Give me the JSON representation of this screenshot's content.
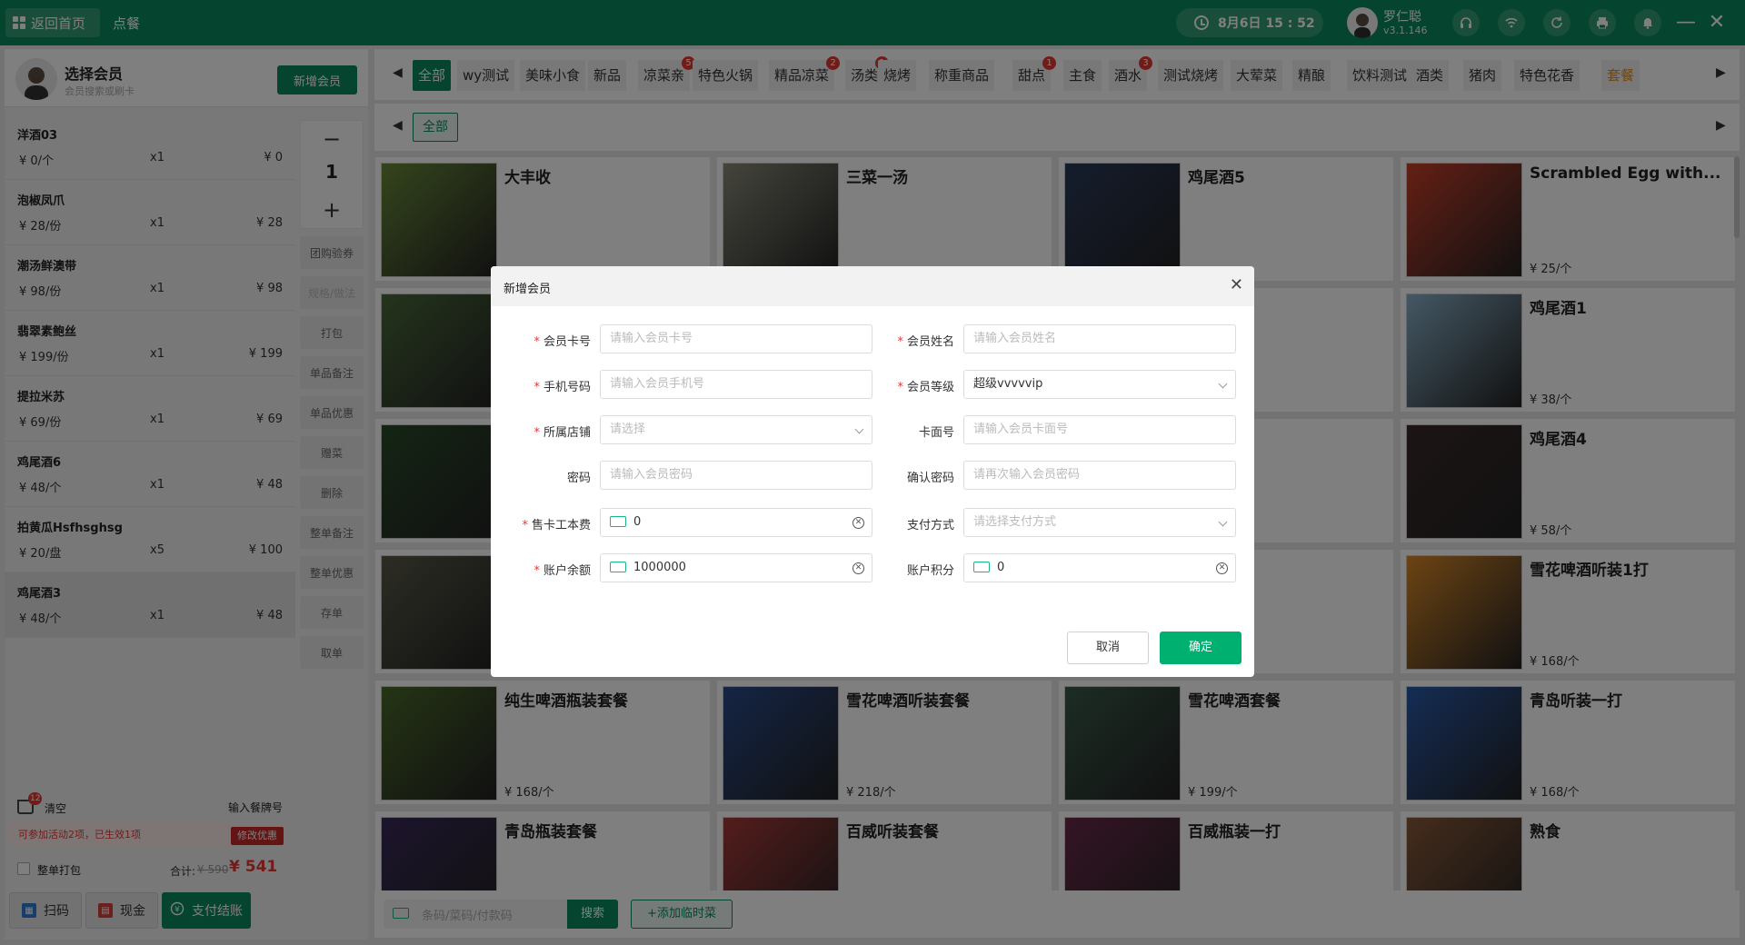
{
  "topbar": {
    "home_label": "返回首页",
    "tab_title": "点餐",
    "datetime": "8月6日  15 : 52",
    "user_name": "罗仁聪",
    "version": "v3.1.146"
  },
  "member": {
    "title": "选择会员",
    "subtitle": "会员搜索或刷卡",
    "add_button": "新增会员"
  },
  "order_items": [
    {
      "name": "洋酒03",
      "price": "¥ 0/个",
      "qty": "x1",
      "total": "¥ 0"
    },
    {
      "name": "泡椒凤爪",
      "price": "¥ 28/份",
      "qty": "x1",
      "total": "¥ 28"
    },
    {
      "name": "潮汤鲜澳带",
      "price": "¥ 98/份",
      "qty": "x1",
      "total": "¥ 98"
    },
    {
      "name": "翡翠素鲍丝",
      "price": "¥ 199/份",
      "qty": "x1",
      "total": "¥ 199"
    },
    {
      "name": "提拉米苏",
      "price": "¥ 69/份",
      "qty": "x1",
      "total": "¥ 69"
    },
    {
      "name": "鸡尾酒6",
      "price": "¥ 48/个",
      "qty": "x1",
      "total": "¥ 48"
    },
    {
      "name": "拍黄瓜Hsfhsghsg",
      "price": "¥ 20/盘",
      "qty": "x5",
      "total": "¥ 100"
    },
    {
      "name": "鸡尾酒3",
      "price": "¥ 48/个",
      "qty": "x1",
      "total": "¥ 48"
    }
  ],
  "stepper": {
    "minus": "−",
    "value": "1",
    "plus": "+"
  },
  "actions": [
    "团购验券",
    "规格/做法",
    "打包",
    "单品备注",
    "单品优惠",
    "赠菜",
    "删除",
    "整单备注",
    "整单优惠",
    "存单",
    "取单"
  ],
  "cart": {
    "badge": "12",
    "clear": "清空",
    "table_no": "输入餐牌号",
    "promo_text": "可参加活动2项，已生效1项",
    "promo_button": "修改优惠",
    "pack_label": "整单打包",
    "sum_label": "合计:",
    "sum_old": "¥ 590",
    "sum_new": "¥ 541"
  },
  "pay_buttons": {
    "scan": "扫码",
    "cash": "现金",
    "checkout": "支付结账"
  },
  "categories": [
    {
      "label": "全部",
      "badge": ""
    },
    {
      "label": "wy测试",
      "badge": ""
    },
    {
      "label": "美味小食",
      "badge": ""
    },
    {
      "label": "新品",
      "badge": ""
    },
    {
      "label": "凉菜亲",
      "badge": "5"
    },
    {
      "label": "特色火锅",
      "badge": ""
    },
    {
      "label": "精品凉菜",
      "badge": "2"
    },
    {
      "label": "汤类",
      "badge": "1"
    },
    {
      "label": "烧烤",
      "badge": ""
    },
    {
      "label": "称重商品",
      "badge": ""
    },
    {
      "label": "甜点",
      "badge": "1"
    },
    {
      "label": "主食",
      "badge": ""
    },
    {
      "label": "酒水",
      "badge": "3"
    },
    {
      "label": "测试烧烤",
      "badge": ""
    },
    {
      "label": "大荤菜",
      "badge": ""
    },
    {
      "label": "精酿",
      "badge": ""
    },
    {
      "label": "饮料测试",
      "badge": ""
    },
    {
      "label": "酒类",
      "badge": ""
    },
    {
      "label": "猪肉",
      "badge": ""
    },
    {
      "label": "特色花香",
      "badge": ""
    },
    {
      "label": "套餐",
      "badge": ""
    }
  ],
  "subcategory": "全部",
  "products": [
    {
      "name": "大丰收",
      "price": "",
      "color": "#6a8a3a"
    },
    {
      "name": "三菜一汤",
      "price": "",
      "color": "#8a8a7a"
    },
    {
      "name": "鸡尾酒5",
      "price": "",
      "color": "#2a3a5a"
    },
    {
      "name": "Scrambled Egg with...",
      "price": "¥ 25/个",
      "color": "#c8402a"
    },
    {
      "name": "",
      "price": "",
      "color": "#4a6a3a"
    },
    {
      "name": "",
      "price": "",
      "color": "#777"
    },
    {
      "name": "",
      "price": "",
      "color": "#777"
    },
    {
      "name": "鸡尾酒1",
      "price": "¥ 38/个",
      "color": "#8ab0c8"
    },
    {
      "name": "",
      "price": "",
      "color": "#2a4a2a"
    },
    {
      "name": "",
      "price": "",
      "color": "#777"
    },
    {
      "name": "",
      "price": "",
      "color": "#777"
    },
    {
      "name": "鸡尾酒4",
      "price": "¥ 58/个",
      "color": "#3a2a2a"
    },
    {
      "name": "",
      "price": "",
      "color": "#5a5a4a"
    },
    {
      "name": "",
      "price": "",
      "color": "#777"
    },
    {
      "name": "",
      "price": "",
      "color": "#777"
    },
    {
      "name": "雪花啤酒听装1打",
      "price": "¥ 168/个",
      "color": "#d8882a"
    },
    {
      "name": "纯生啤酒瓶装套餐",
      "price": "¥ 168/个",
      "color": "#4a6a2a"
    },
    {
      "name": "雪花啤酒听装套餐",
      "price": "¥ 218/个",
      "color": "#2a4a8a"
    },
    {
      "name": "雪花啤酒套餐",
      "price": "¥ 199/个",
      "color": "#3a5a4a"
    },
    {
      "name": "青岛听装一打",
      "price": "¥ 168/个",
      "color": "#2a5aa8"
    },
    {
      "name": "青岛瓶装套餐",
      "price": "",
      "color": "#3a2a5a"
    },
    {
      "name": "百威听装套餐",
      "price": "",
      "color": "#a83a3a"
    },
    {
      "name": "百威瓶装一打",
      "price": "",
      "color": "#6a2a4a"
    },
    {
      "name": "熟食",
      "price": "",
      "color": "#8a5a3a"
    }
  ],
  "bottom": {
    "scan_placeholder": "条码/菜码/付款码",
    "search": "搜索",
    "add_time": "+添加临时菜"
  },
  "modal": {
    "title": "新增会员",
    "fields": {
      "card_no": {
        "label": "会员卡号",
        "placeholder": "请输入会员卡号"
      },
      "name": {
        "label": "会员姓名",
        "placeholder": "请输入会员姓名"
      },
      "phone": {
        "label": "手机号码",
        "placeholder": "请输入会员手机号"
      },
      "level": {
        "label": "会员等级",
        "value": "超级vvvvvip"
      },
      "store": {
        "label": "所属店铺",
        "placeholder": "请选择"
      },
      "card_face": {
        "label": "卡面号",
        "placeholder": "请输入会员卡面号"
      },
      "password": {
        "label": "密码",
        "placeholder": "请输入会员密码"
      },
      "confirm_password": {
        "label": "确认密码",
        "placeholder": "请再次输入会员密码"
      },
      "card_fee": {
        "label": "售卡工本费",
        "value": "0"
      },
      "pay_method": {
        "label": "支付方式",
        "placeholder": "请选择支付方式"
      },
      "balance": {
        "label": "账户余额",
        "value": "1000000"
      },
      "points": {
        "label": "账户积分",
        "value": "0"
      }
    },
    "cancel": "取消",
    "confirm": "确定"
  }
}
